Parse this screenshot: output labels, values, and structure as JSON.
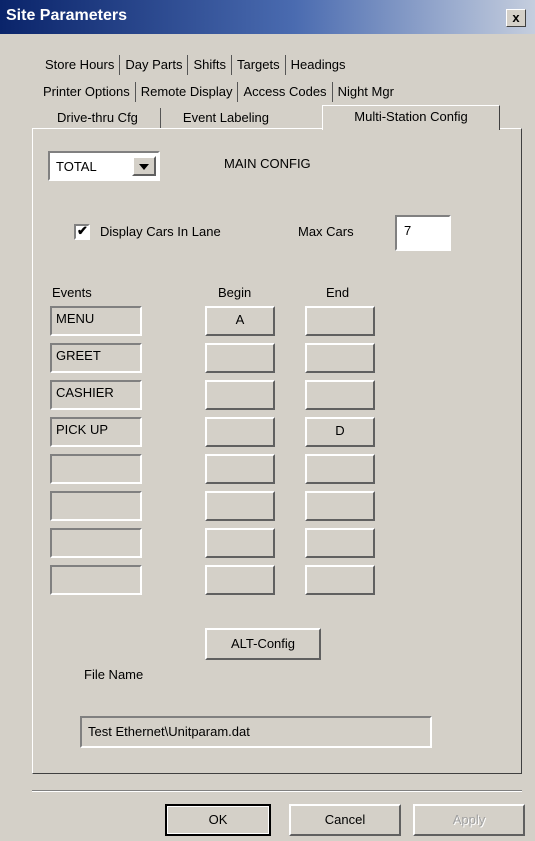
{
  "window": {
    "title": "Site Parameters",
    "close_label": "x"
  },
  "tabs": {
    "row1": [
      "Store Hours",
      "Day Parts",
      "Shifts",
      "Targets",
      "Headings"
    ],
    "row2": [
      "Printer Options",
      "Remote Display",
      "Access Codes",
      "Night Mgr"
    ],
    "row3": [
      "Drive-thru Cfg",
      "Event Labeling"
    ],
    "active": "Multi-Station Config"
  },
  "config": {
    "selector_value": "TOTAL",
    "heading": "MAIN CONFIG",
    "display_cars_label": "Display Cars In Lane",
    "display_cars_checked": true,
    "max_cars_label": "Max Cars",
    "max_cars_value": "7"
  },
  "events_table": {
    "headers": {
      "events": "Events",
      "begin": "Begin",
      "end": "End"
    },
    "rows": [
      {
        "event": "MENU",
        "begin": "A",
        "end": ""
      },
      {
        "event": "GREET",
        "begin": "",
        "end": ""
      },
      {
        "event": "CASHIER",
        "begin": "",
        "end": ""
      },
      {
        "event": "PICK UP",
        "begin": "",
        "end": "D"
      },
      {
        "event": "",
        "begin": "",
        "end": ""
      },
      {
        "event": "",
        "begin": "",
        "end": ""
      },
      {
        "event": "",
        "begin": "",
        "end": ""
      },
      {
        "event": "",
        "begin": "",
        "end": ""
      }
    ]
  },
  "alt_config_label": "ALT-Config",
  "file": {
    "label": "File Name",
    "value": "Test Ethernet\\Unitparam.dat"
  },
  "footer": {
    "ok": "OK",
    "cancel": "Cancel",
    "apply": "Apply"
  },
  "colors": {
    "face": "#d4d0c8",
    "title_start": "#0a246a",
    "title_end": "#c5cede",
    "disabled_text": "#a0a0a0"
  }
}
